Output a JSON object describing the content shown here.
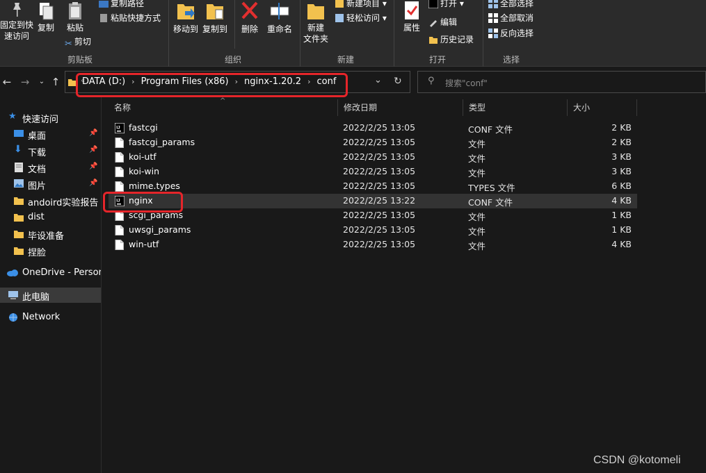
{
  "ribbon": {
    "pin_quick": "固定到快\n速访问",
    "copy": "复制",
    "paste": "粘贴",
    "copy_path": "复制路径",
    "paste_shortcut": "粘贴快捷方式",
    "cut": "剪切",
    "group_clipboard": "剪贴板",
    "move_to": "移动到",
    "copy_to": "复制到",
    "delete": "删除",
    "rename": "重命名",
    "group_organize": "组织",
    "new_folder": "新建\n文件夹",
    "new_item": "新建项目 ▾",
    "easy_access": "轻松访问 ▾",
    "group_new": "新建",
    "properties": "属性",
    "open": "打开 ▾",
    "edit": "编辑",
    "history": "历史记录",
    "group_open": "打开",
    "select_all": "全部选择",
    "select_none": "全部取消",
    "invert_selection": "反向选择",
    "group_select": "选择"
  },
  "address": {
    "crumbs": [
      "DATA (D:)",
      "Program Files (x86)",
      "nginx-1.20.2",
      "conf"
    ],
    "search_placeholder": "搜索\"conf\""
  },
  "nav": {
    "quick_access": "快速访问",
    "items": [
      {
        "label": "桌面",
        "pinned": true
      },
      {
        "label": "下载",
        "pinned": true
      },
      {
        "label": "文档",
        "pinned": true
      },
      {
        "label": "图片",
        "pinned": true
      },
      {
        "label": "andoird实验报告",
        "pinned": false
      },
      {
        "label": "dist",
        "pinned": false
      },
      {
        "label": "毕设准备",
        "pinned": false
      },
      {
        "label": "捏脸",
        "pinned": false
      }
    ],
    "onedrive": "OneDrive - Persona",
    "this_pc": "此电脑",
    "network": "Network"
  },
  "columns": {
    "name": "名称",
    "modified": "修改日期",
    "type": "类型",
    "size": "大小"
  },
  "files": [
    {
      "name": "fastcgi",
      "modified": "2022/2/25 13:05",
      "type": "CONF 文件",
      "size": "2 KB",
      "icon": "idea-icon"
    },
    {
      "name": "fastcgi_params",
      "modified": "2022/2/25 13:05",
      "type": "文件",
      "size": "2 KB",
      "icon": "file-icon"
    },
    {
      "name": "koi-utf",
      "modified": "2022/2/25 13:05",
      "type": "文件",
      "size": "3 KB",
      "icon": "file-icon"
    },
    {
      "name": "koi-win",
      "modified": "2022/2/25 13:05",
      "type": "文件",
      "size": "3 KB",
      "icon": "file-icon"
    },
    {
      "name": "mime.types",
      "modified": "2022/2/25 13:05",
      "type": "TYPES 文件",
      "size": "6 KB",
      "icon": "file-icon"
    },
    {
      "name": "nginx",
      "modified": "2022/2/25 13:22",
      "type": "CONF 文件",
      "size": "4 KB",
      "icon": "idea-icon"
    },
    {
      "name": "scgi_params",
      "modified": "2022/2/25 13:05",
      "type": "文件",
      "size": "1 KB",
      "icon": "file-icon"
    },
    {
      "name": "uwsgi_params",
      "modified": "2022/2/25 13:05",
      "type": "文件",
      "size": "1 KB",
      "icon": "file-icon"
    },
    {
      "name": "win-utf",
      "modified": "2022/2/25 13:05",
      "type": "文件",
      "size": "4 KB",
      "icon": "file-icon"
    }
  ],
  "watermark": "CSDN @kotomeli",
  "colors": {
    "highlight": "#e5252a",
    "folder": "#f2c14e",
    "accent": "#2f78c4"
  }
}
